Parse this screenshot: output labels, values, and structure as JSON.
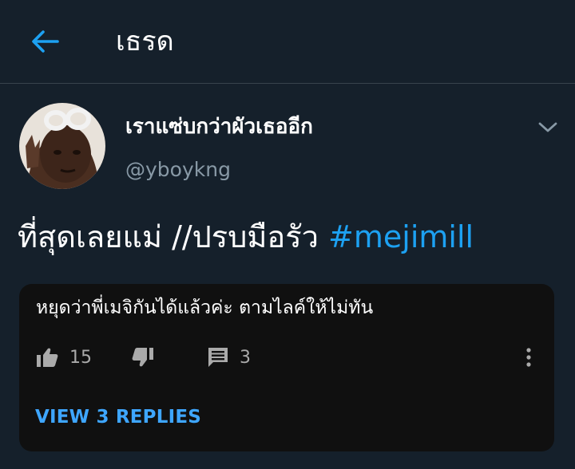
{
  "header": {
    "back_icon": "arrow-left-icon",
    "title": "เธรด",
    "accent": "#1da1f2"
  },
  "tweet": {
    "display_name": "เราแซ่บกว่าผัวเธออีก",
    "handle": "@yboykng",
    "text": "ที่สุดเลยแม่ //ปรบมือรัว ",
    "hashtag": "#mejimill",
    "caret_icon": "chevron-down-icon"
  },
  "embedded_comment": {
    "text": "หยุดว่าพี่เมจิกันได้แล้วค่ะ ตามไลค์ให้ไม่ทัน",
    "like_count": "15",
    "reply_count": "3",
    "view_replies": "VIEW 3 REPLIES",
    "icons": {
      "like": "thumbs-up-icon",
      "dislike": "thumbs-down-icon",
      "reply": "comment-icon",
      "more": "more-vertical-icon"
    }
  }
}
